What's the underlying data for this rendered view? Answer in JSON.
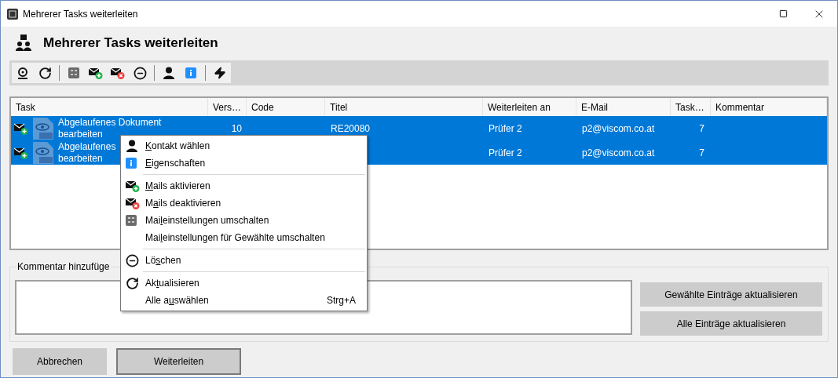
{
  "window": {
    "title": "Mehrerer Tasks weiterleiten"
  },
  "header": {
    "title": "Mehrerer Tasks weiterleiten"
  },
  "toolbar": [
    {
      "kind": "disc"
    },
    {
      "kind": "refresh"
    },
    {
      "kind": "sep"
    },
    {
      "kind": "settings"
    },
    {
      "kind": "mail-on"
    },
    {
      "kind": "mail-off"
    },
    {
      "kind": "remove"
    },
    {
      "kind": "sep"
    },
    {
      "kind": "user"
    },
    {
      "kind": "info"
    },
    {
      "kind": "sep"
    },
    {
      "kind": "bolt"
    }
  ],
  "table": {
    "columns": [
      "Task",
      "Vers…",
      "Code",
      "Titel",
      "Weiterleiten an",
      "E-Mail",
      "Task…",
      "Kommentar"
    ],
    "rows": [
      {
        "selected": true,
        "mail": true,
        "task": [
          "Abgelaufenes Dokument",
          "bearbeiten"
        ],
        "version": "10",
        "title": "RE20080",
        "forward_to": "Prüfer 2",
        "email": "p2@viscom.co.at",
        "tasks": "7"
      },
      {
        "selected": true,
        "mail": true,
        "task": [
          "Abgelaufenes",
          "bearbeiten"
        ],
        "forward_to": "Prüfer 2",
        "email": "p2@viscom.co.at",
        "tasks": "7"
      }
    ]
  },
  "comment": {
    "legend": "Kommentar hinzufüge"
  },
  "side_buttons": [
    "Gewählte Einträge aktualisieren",
    "Alle Einträge aktualisieren"
  ],
  "buttons": [
    {
      "label": "Abbrechen",
      "default": false
    },
    {
      "label": "Weiterleiten",
      "default": true
    }
  ],
  "context_menu": [
    {
      "kind": "user",
      "label": {
        "access_key": "K",
        "after": "ontakt wählen"
      }
    },
    {
      "kind": "info",
      "label": {
        "access_key": "E",
        "after": "igenschaften"
      }
    },
    {
      "kind": "separator"
    },
    {
      "kind": "mail-on",
      "label": {
        "access_key": "M",
        "after": "ails aktivieren"
      }
    },
    {
      "kind": "mail-off",
      "label": {
        "before": "M",
        "access_key": "a",
        "after": "ils deaktivieren"
      }
    },
    {
      "kind": "settings",
      "label": {
        "before": "Mai",
        "access_key": "l",
        "after": "einstellungen umschalten"
      }
    },
    {
      "kind": "plain",
      "label": {
        "before": "Mai",
        "access_key": "l",
        "after": "einstellungen für Gewählte umschalten"
      }
    },
    {
      "kind": "separator"
    },
    {
      "kind": "remove",
      "label": {
        "before": "Lö",
        "access_key": "s",
        "after": "chen"
      }
    },
    {
      "kind": "separator"
    },
    {
      "kind": "refresh",
      "label": {
        "before": "Ak",
        "access_key": "t",
        "after": "ualisieren"
      }
    },
    {
      "kind": "plain",
      "label": {
        "before": "Alle a",
        "access_key": "u",
        "after": "swählen"
      },
      "shortcut": "Strg+A"
    }
  ]
}
